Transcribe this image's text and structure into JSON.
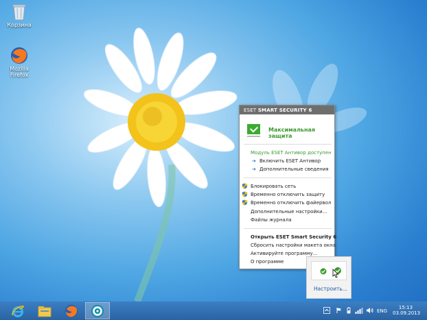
{
  "desktop": {
    "icons": [
      {
        "label": "Корзина",
        "icon": "recycle-bin-icon"
      },
      {
        "label": "Mozilla\nFirefox",
        "icon": "firefox-icon"
      }
    ]
  },
  "eset_popup": {
    "brand_light": "ESET",
    "brand_bold": "SMART SECURITY 6",
    "status": "Максимальная защита",
    "module_notice": "Модуль ESET Антивор доступен",
    "links": [
      "Включить ESET Антивор",
      "Дополнительные сведения"
    ],
    "menu_shield": [
      "Блокировать сеть",
      "Временно отключить защиту",
      "Временно отключить файервол"
    ],
    "menu_plain": [
      "Дополнительные настройки...",
      "Файлы журнала"
    ],
    "menu_bottom": [
      "Открыть ESET Smart Security 6",
      "Сбросить настройки макета окна",
      "Активируйте программу...",
      "О программе"
    ]
  },
  "tray_popup": {
    "settings_link": "Настроить..."
  },
  "taskbar": {
    "apps": [
      "internet-explorer-icon",
      "file-explorer-icon",
      "firefox-icon",
      "eset-icon"
    ],
    "language": "ENG",
    "time": "15:13",
    "date": "03.09.2013"
  },
  "colors": {
    "eset_green": "#3dab33",
    "header_gray": "#6e6e6e",
    "taskbar_blue": "#2f6fb0",
    "link_blue": "#1f5ea8"
  }
}
